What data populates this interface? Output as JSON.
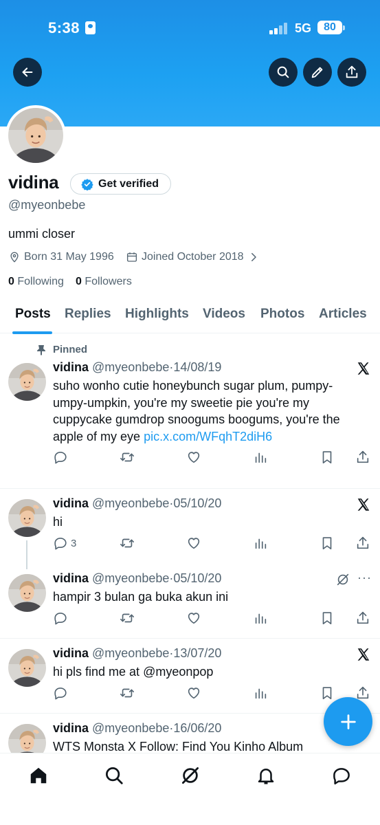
{
  "status_bar": {
    "time": "5:38",
    "network": "5G",
    "battery": "80"
  },
  "profile": {
    "name": "vidina",
    "verify_label": "Get verified",
    "handle": "@myeonbebe",
    "bio": "ummi closer",
    "born": "Born 31 May 1996",
    "joined": "Joined October 2018",
    "following_count": "0",
    "following_label": "Following",
    "followers_count": "0",
    "followers_label": "Followers"
  },
  "tabs": [
    "Posts",
    "Replies",
    "Highlights",
    "Videos",
    "Photos",
    "Articles"
  ],
  "pinned_label": "Pinned",
  "posts": [
    {
      "name": "vidina",
      "handle": "@myeonbebe",
      "dot": "·",
      "date": "14/08/19",
      "text": "suho wonho cutie honeybunch sugar plum, pumpy-umpy-umpkin, you're my sweetie pie you're my cuppycake gumdrop snoogums boogums, you're the apple of my eye ",
      "link": "pic.x.com/WFqhT2diH6",
      "reply_count": ""
    },
    {
      "name": "vidina",
      "handle": "@myeonbebe",
      "dot": "·",
      "date": "05/10/20",
      "text": "hi",
      "reply_count": "3"
    },
    {
      "name": "vidina",
      "handle": "@myeonbebe",
      "dot": "·",
      "date": "05/10/20",
      "text": "hampir 3 bulan ga buka akun ini",
      "reply_count": "",
      "more": "···"
    },
    {
      "name": "vidina",
      "handle": "@myeonbebe",
      "dot": "·",
      "date": "13/07/20",
      "text": "hi pls find me at @myeonpop",
      "reply_count": ""
    },
    {
      "name": "vidina",
      "handle": "@myeonbebe",
      "dot": "·",
      "date": "16/06/20",
      "text": "WTS Monsta X Follow: Find You Kinho Album"
    }
  ],
  "colors": {
    "accent": "#1d9bf0",
    "banner": "#1da1f2",
    "text": "#0f1419",
    "muted": "#536471"
  },
  "icons": [
    "back-arrow-icon",
    "search-icon",
    "edit-icon",
    "share-icon",
    "verified-badge-icon",
    "location-icon",
    "calendar-icon",
    "chevron-right-icon",
    "pin-icon",
    "x-logo-icon",
    "reply-icon",
    "repost-icon",
    "like-icon",
    "views-icon",
    "bookmark-icon",
    "home-icon",
    "grok-icon",
    "bell-icon",
    "messages-icon",
    "plus-icon"
  ]
}
